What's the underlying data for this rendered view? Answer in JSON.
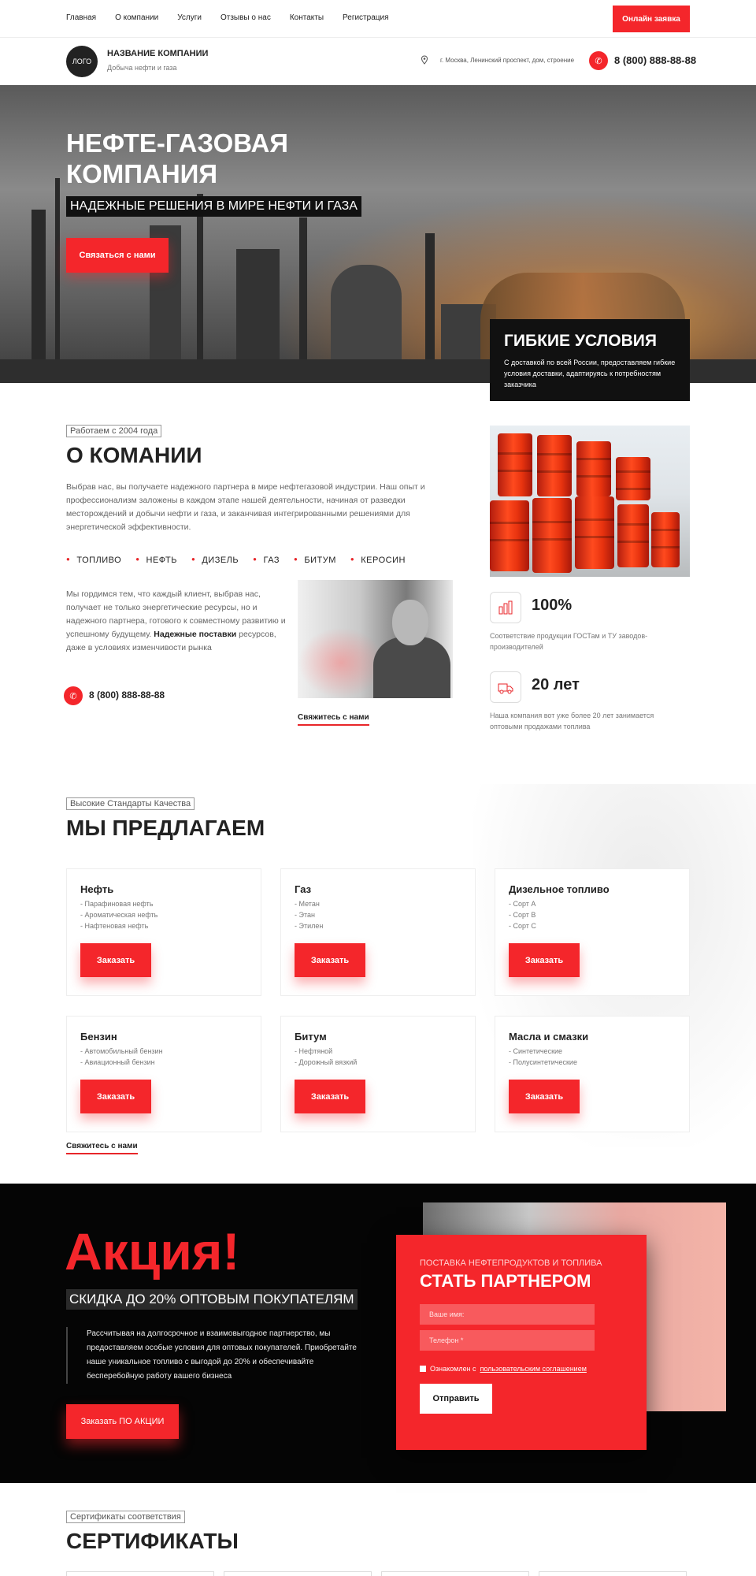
{
  "topnav": {
    "items": [
      "Главная",
      "О компании",
      "Услуги",
      "Отзывы о нас",
      "Контакты",
      "Регистрация"
    ],
    "online_btn": "Онлайн заявка"
  },
  "header": {
    "logo": "ЛОГО",
    "company_name": "НАЗВАНИЕ КОМПАНИИ",
    "company_sub": "Добыча нефти и газа",
    "address": "г. Москва, Ленинский проспект, дом, строение",
    "phone": "8 (800) 888-88-88"
  },
  "hero": {
    "title_line1": "НЕФТЕ-ГАЗОВАЯ",
    "title_line2": "КОМПАНИЯ",
    "tagline": "НАДЕЖНЫЕ РЕШЕНИЯ В МИРЕ НЕФТИ И ГАЗА",
    "cta": "Связаться с нами",
    "flex_title": "ГИБКИЕ УСЛОВИЯ",
    "flex_text": "С доставкой по всей России, предоставляем гибкие условия доставки, адаптируясь к потребностям заказчика"
  },
  "about": {
    "tag": "Работаем с 2004 года",
    "title": "О КОМАНИИ",
    "text": "Выбрав нас, вы получаете надежного партнера в мире нефтегазовой индустрии. Наш опыт и профессионализм заложены в каждом этапе нашей деятельности, начиная от разведки месторождений и добычи нефти и газа, и заканчивая интегрированными решениями для энергетической эффективности.",
    "products": [
      "ТОПЛИВО",
      "НЕФТЬ",
      "ДИЗЕЛЬ",
      "ГАЗ",
      "БИТУМ",
      "КЕРОСИН"
    ],
    "text2_part1": "Мы гордимся тем, что каждый клиент, выбрав нас, получает не только энергетические ресурсы, но и надежного партнера, готового к совместному развитию и успешному будущему.",
    "text2_bold": "Надежные поставки",
    "text2_part2": "ресурсов, даже в условиях изменчивости рынка",
    "phone": "8 (800) 888-88-88",
    "contact_link": "Свяжитесь с нами",
    "stat1_value": "100%",
    "stat1_text": "Соответствие продукции ГОСТам и ТУ заводов-производителей",
    "stat2_value": "20 лет",
    "stat2_text": "Наша компания вот уже более 20 лет занимается оптовыми продажами топлива"
  },
  "offers": {
    "tag": "Высокие Стандарты Качества",
    "title": "МЫ ПРЕДЛАГАЕМ",
    "order_label": "Заказать",
    "contact_link": "Свяжитесь с нами",
    "cards": [
      {
        "title": "Нефть",
        "items": [
          "- Парафиновая нефть",
          "- Ароматическая нефть",
          "- Нафтеновая нефть"
        ]
      },
      {
        "title": "Газ",
        "items": [
          "- Метан",
          "- Этан",
          "- Этилен"
        ]
      },
      {
        "title": "Дизельное топливо",
        "items": [
          "- Сорт А",
          "- Сорт В",
          "- Сорт С"
        ]
      },
      {
        "title": "Бензин",
        "items": [
          "- Автомобильный бензин",
          "- Авиационный бензин"
        ]
      },
      {
        "title": "Битум",
        "items": [
          "- Нефтяной",
          "- Дорожный вязкий"
        ]
      },
      {
        "title": "Масла и смазки",
        "items": [
          "- Синтетические",
          "- Полусинтетические"
        ]
      }
    ]
  },
  "promo": {
    "title": "Акция!",
    "discount": "СКИДКА ДО 20% ОПТОВЫМ ПОКУПАТЕЛЯМ",
    "text": "Рассчитывая на долгосрочное и взаимовыгодное партнерство, мы предоставляем особые условия для оптовых покупателей. Приобретайте наше уникальное топливо с выгодой до 20% и обеспечивайте бесперебойную работу вашего бизнеса",
    "cta": "Заказать ПО АКЦИИ",
    "form_sub": "ПОСТАВКА НЕФТЕПРОДУКТОВ И ТОПЛИВА",
    "form_title": "СТАТЬ ПАРТНЕРОМ",
    "name_placeholder": "Ваше имя:",
    "phone_placeholder": "Телефон *",
    "agree_text": "Ознакомлен с",
    "agree_link": "пользовательским соглашением",
    "submit": "Отправить"
  },
  "certs": {
    "tag": "Сертификаты соответствия",
    "title": "СЕРТИФИКАТЫ"
  },
  "colors": {
    "accent": "#f4262b",
    "dark": "#050505"
  },
  "icons": [
    "location-icon",
    "phone-icon",
    "product-quality-icon",
    "fuel-truck-icon"
  ]
}
